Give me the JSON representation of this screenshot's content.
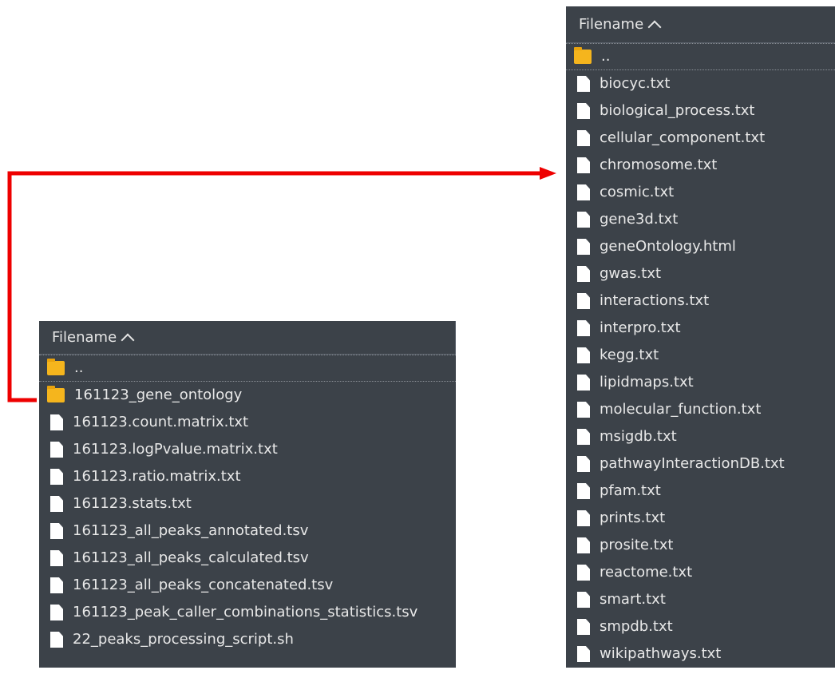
{
  "colors": {
    "panel_bg": "#3c4249",
    "text": "#e8e8e8",
    "folder": "#f5b51d",
    "file": "#ffffff",
    "connector": "#ee0000"
  },
  "left_panel": {
    "header": "Filename",
    "sort_icon": "chevron-up-icon",
    "rows": [
      {
        "label": "..",
        "icon": "folder-icon"
      },
      {
        "label": "161123_gene_ontology",
        "icon": "folder-icon"
      },
      {
        "label": "161123.count.matrix.txt",
        "icon": "file-icon"
      },
      {
        "label": "161123.logPvalue.matrix.txt",
        "icon": "file-icon"
      },
      {
        "label": "161123.ratio.matrix.txt",
        "icon": "file-icon"
      },
      {
        "label": "161123.stats.txt",
        "icon": "file-icon"
      },
      {
        "label": "161123_all_peaks_annotated.tsv",
        "icon": "file-icon"
      },
      {
        "label": "161123_all_peaks_calculated.tsv",
        "icon": "file-icon"
      },
      {
        "label": "161123_all_peaks_concatenated.tsv",
        "icon": "file-icon"
      },
      {
        "label": "161123_peak_caller_combinations_statistics.tsv",
        "icon": "file-icon"
      },
      {
        "label": "22_peaks_processing_script.sh",
        "icon": "file-icon"
      }
    ]
  },
  "right_panel": {
    "header": "Filename",
    "sort_icon": "chevron-up-icon",
    "rows": [
      {
        "label": "..",
        "icon": "folder-icon"
      },
      {
        "label": "biocyc.txt",
        "icon": "file-icon"
      },
      {
        "label": "biological_process.txt",
        "icon": "file-icon"
      },
      {
        "label": "cellular_component.txt",
        "icon": "file-icon"
      },
      {
        "label": "chromosome.txt",
        "icon": "file-icon"
      },
      {
        "label": "cosmic.txt",
        "icon": "file-icon"
      },
      {
        "label": "gene3d.txt",
        "icon": "file-icon"
      },
      {
        "label": "geneOntology.html",
        "icon": "file-icon"
      },
      {
        "label": "gwas.txt",
        "icon": "file-icon"
      },
      {
        "label": "interactions.txt",
        "icon": "file-icon"
      },
      {
        "label": "interpro.txt",
        "icon": "file-icon"
      },
      {
        "label": "kegg.txt",
        "icon": "file-icon"
      },
      {
        "label": "lipidmaps.txt",
        "icon": "file-icon"
      },
      {
        "label": "molecular_function.txt",
        "icon": "file-icon"
      },
      {
        "label": "msigdb.txt",
        "icon": "file-icon"
      },
      {
        "label": "pathwayInteractionDB.txt",
        "icon": "file-icon"
      },
      {
        "label": "pfam.txt",
        "icon": "file-icon"
      },
      {
        "label": "prints.txt",
        "icon": "file-icon"
      },
      {
        "label": "prosite.txt",
        "icon": "file-icon"
      },
      {
        "label": "reactome.txt",
        "icon": "file-icon"
      },
      {
        "label": "smart.txt",
        "icon": "file-icon"
      },
      {
        "label": "smpdb.txt",
        "icon": "file-icon"
      },
      {
        "label": "wikipathways.txt",
        "icon": "file-icon"
      }
    ]
  }
}
